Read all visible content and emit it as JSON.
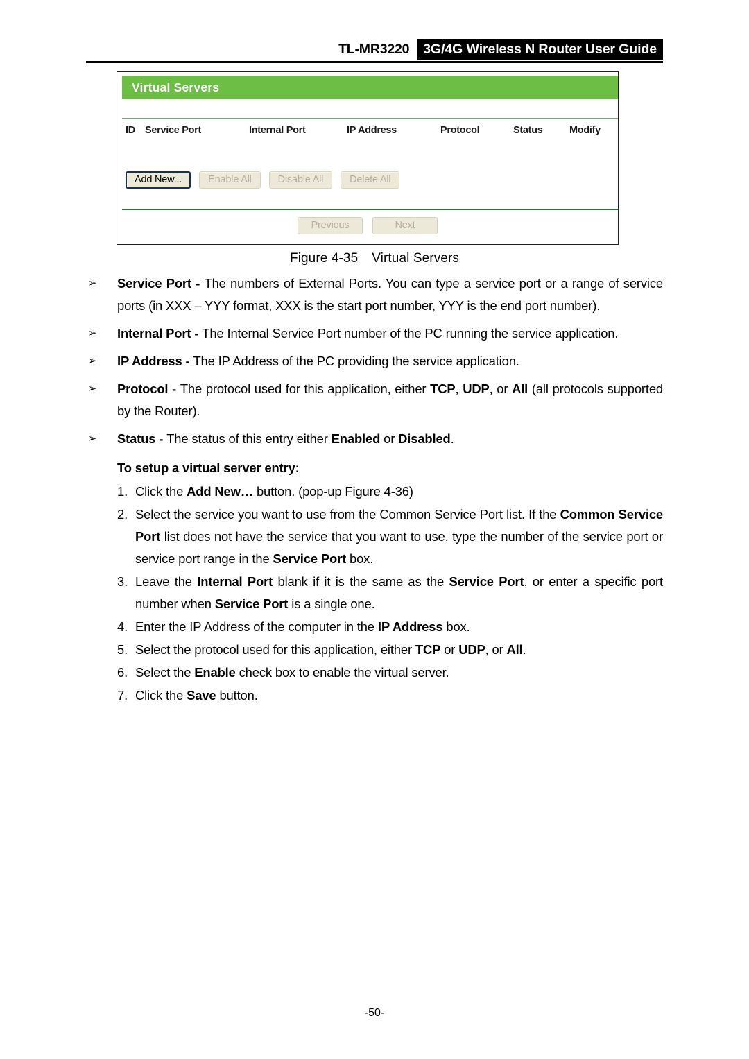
{
  "header": {
    "model": "TL-MR3220",
    "guide_title": "3G/4G Wireless N Router User Guide"
  },
  "screenshot": {
    "panel_title": "Virtual Servers",
    "accent_green": "#6cbe45",
    "separator_green": "#2d6e3e",
    "button_face": "#ece9d8",
    "table": {
      "columns": [
        "ID",
        "Service Port",
        "Internal Port",
        "IP Address",
        "Protocol",
        "Status",
        "Modify"
      ],
      "rows": []
    },
    "action_buttons": [
      {
        "label": "Add New...",
        "state": "enabled"
      },
      {
        "label": "Enable All",
        "state": "disabled"
      },
      {
        "label": "Disable All",
        "state": "disabled"
      },
      {
        "label": "Delete All",
        "state": "disabled"
      }
    ],
    "pager_buttons": [
      {
        "label": "Previous",
        "state": "disabled"
      },
      {
        "label": "Next",
        "state": "disabled"
      }
    ]
  },
  "figure": {
    "number": "Figure 4-35",
    "title": "Virtual Servers"
  },
  "bullets": [
    {
      "glyph": "➢",
      "term": "Service Port",
      "dash": " - ",
      "text": "The numbers of External Ports. You can type a service port or a range of service ports (in XXX – YYY format, XXX is the start port number, YYY is the end port number)."
    },
    {
      "glyph": "➢",
      "term": "Internal Port",
      "dash": " - ",
      "text": "The Internal Service Port number of the PC running the service application."
    },
    {
      "glyph": "➢",
      "term": "IP Address",
      "dash": " - ",
      "text": "The IP Address of the PC providing the service application."
    },
    {
      "glyph": "➢",
      "term": "Protocol",
      "dash": " - ",
      "text_a": "The protocol used for this application, either ",
      "b1": "TCP",
      "text_b": ", ",
      "b2": "UDP",
      "text_c": ", or ",
      "b3": "All",
      "text_d": " (all protocols supported by the Router)."
    },
    {
      "glyph": "➢",
      "term": "Status",
      "dash": " - ",
      "text_a": "The status of this entry either ",
      "b1": "Enabled",
      "text_b": " or ",
      "b2": "Disabled",
      "text_c": "."
    }
  ],
  "procedure": {
    "heading": "To setup a virtual server entry:",
    "steps": [
      {
        "num": "1.",
        "a": "Click the ",
        "b1": "Add New…",
        "b": " button. (pop-up Figure 4-36)"
      },
      {
        "num": "2.",
        "a": "Select the service you want to use from the Common Service Port list. If the ",
        "b1": "Common Service Port",
        "b": " list does not have the service that you want to use, type the number of the service port or service port range in the ",
        "b2": "Service Port",
        "c": " box."
      },
      {
        "num": "3.",
        "a": "Leave the ",
        "b1": "Internal Port",
        "b": " blank if it is the same as the ",
        "b2": "Service Port",
        "c": ", or enter a specific port number when ",
        "b3": "Service Port",
        "d": " is a single one."
      },
      {
        "num": "4.",
        "a": "Enter the IP Address of the computer in the ",
        "b1": "IP Address",
        "b": " box."
      },
      {
        "num": "5.",
        "a": "Select the protocol used for this application, either ",
        "b1": "TCP",
        "b": " or ",
        "b2": "UDP",
        "c": ", or ",
        "b3": "All",
        "d": "."
      },
      {
        "num": "6.",
        "a": "Select the ",
        "b1": "Enable",
        "b": " check box to enable the virtual server."
      },
      {
        "num": "7.",
        "a": "Click the ",
        "b1": "Save",
        "b": " button."
      }
    ]
  },
  "footer": {
    "page_number": "-50-"
  }
}
